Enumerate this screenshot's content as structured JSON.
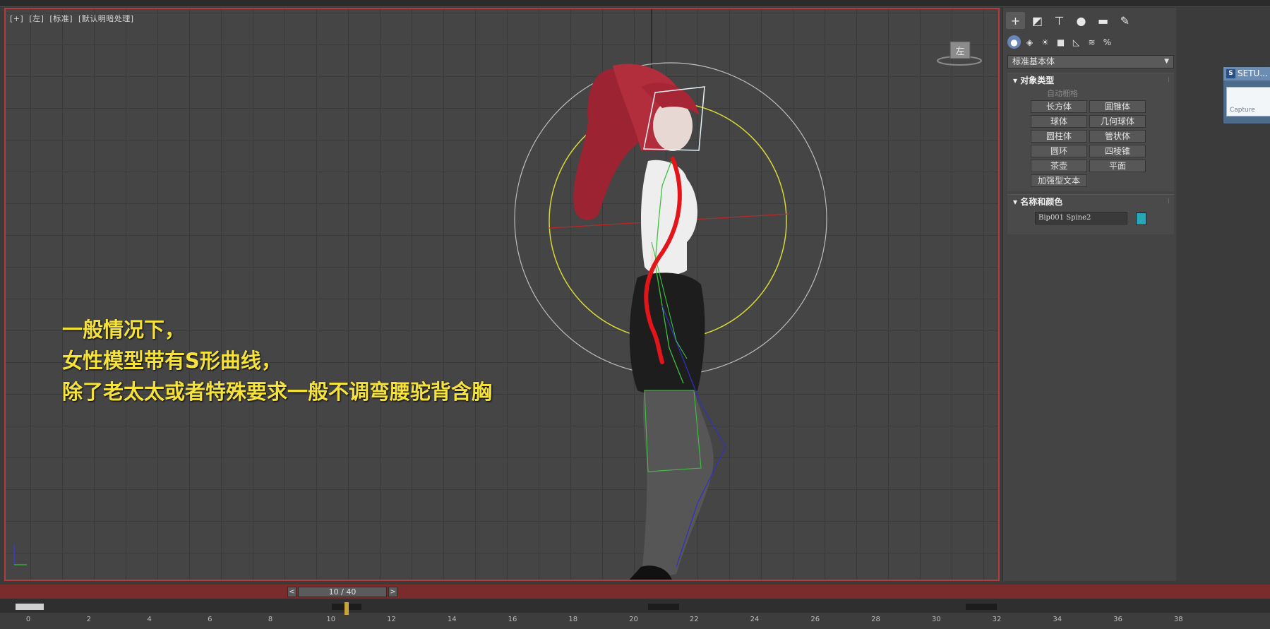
{
  "viewport": {
    "labels": [
      "[+]",
      "[左]",
      "[标准]",
      "[默认明暗处理]"
    ],
    "viewcube_label": "左",
    "caption_lines": [
      "一般情况下，",
      "女性模型带有S形曲线，",
      "除了老太太或者特殊要求一般不调弯腰驼背含胸"
    ],
    "caption_color": "#f5e23a",
    "border_color": "#b43c3c"
  },
  "command_panel": {
    "tabs": [
      {
        "name": "create-tab",
        "glyph": "+",
        "active": true
      },
      {
        "name": "modify-tab",
        "glyph": "◩",
        "active": false
      },
      {
        "name": "hierarchy-tab",
        "glyph": "⊤",
        "active": false
      },
      {
        "name": "motion-tab",
        "glyph": "●",
        "active": false
      },
      {
        "name": "display-tab",
        "glyph": "▬",
        "active": false
      },
      {
        "name": "utilities-tab",
        "glyph": "🔧",
        "active": false
      }
    ],
    "subtabs": [
      {
        "name": "geometry-icon",
        "glyph": "●",
        "active": true
      },
      {
        "name": "shapes-icon",
        "glyph": "◈",
        "active": false
      },
      {
        "name": "lights-icon",
        "glyph": "💡",
        "active": false
      },
      {
        "name": "cameras-icon",
        "glyph": "■",
        "active": false
      },
      {
        "name": "helpers-icon",
        "glyph": "◺",
        "active": false
      },
      {
        "name": "spacewarps-icon",
        "glyph": "≋",
        "active": false
      },
      {
        "name": "systems-icon",
        "glyph": "%",
        "active": false
      }
    ],
    "category_dropdown": "标准基本体",
    "object_type": {
      "title": "对象类型",
      "autogrid": "自动栅格",
      "buttons": [
        "长方体",
        "圆锥体",
        "球体",
        "几何球体",
        "圆柱体",
        "管状体",
        "圆环",
        "四棱锥",
        "茶壶",
        "平面",
        "加强型文本"
      ]
    },
    "name_color": {
      "title": "名称和颜色",
      "object_name": "Bip001 Spine2",
      "color": "#28a6b6"
    }
  },
  "setup_window": {
    "title": "SETU...",
    "body_label": "Capture"
  },
  "timeline": {
    "current_frame": 10,
    "total_frames": 40,
    "slider_label": "10 / 40",
    "prev_arrow": "<",
    "next_arrow": ">",
    "ticks": [
      "0",
      "2",
      "4",
      "6",
      "8",
      "10",
      "12",
      "14",
      "16",
      "18",
      "20",
      "22",
      "24",
      "26",
      "28",
      "30",
      "32",
      "34",
      "36",
      "38"
    ]
  }
}
